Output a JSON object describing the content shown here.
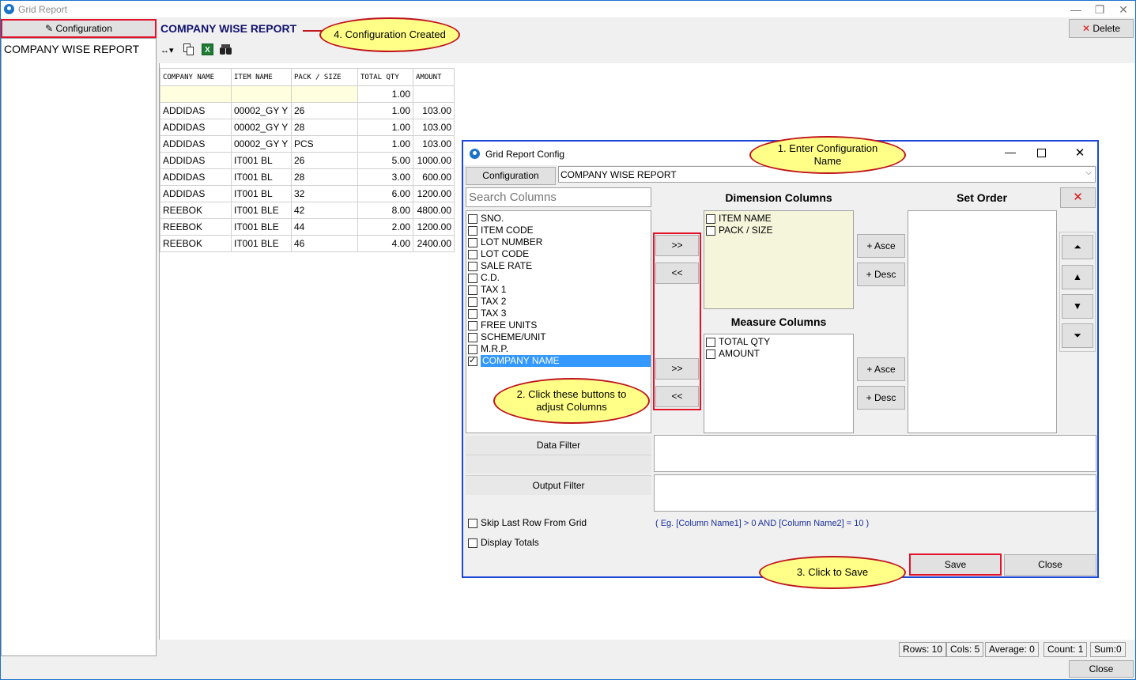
{
  "window": {
    "title": "Grid Report",
    "controls": {
      "minimize": "—",
      "restore": "❐",
      "close": "✕"
    }
  },
  "toolbar": {
    "configuration_label": "Configuration",
    "report_title": "COMPANY WISE REPORT",
    "delete_label": "Delete",
    "icons": [
      "fit-columns-icon",
      "copy-icon",
      "excel-icon",
      "binoculars-icon"
    ]
  },
  "sidebar": {
    "items": [
      {
        "label": "COMPANY WISE REPORT"
      }
    ]
  },
  "grid": {
    "columns": [
      "COMPANY NAME",
      "ITEM NAME",
      "PACK / SIZE",
      "TOTAL QTY",
      "AMOUNT"
    ],
    "rows": [
      [
        "",
        "",
        "",
        "1.00",
        ""
      ],
      [
        "ADDIDAS",
        "00002_GY Y",
        "26",
        "1.00",
        "103.00"
      ],
      [
        "ADDIDAS",
        "00002_GY Y",
        "28",
        "1.00",
        "103.00"
      ],
      [
        "ADDIDAS",
        "00002_GY Y",
        "PCS",
        "1.00",
        "103.00"
      ],
      [
        "ADDIDAS",
        "IT001 BL",
        "26",
        "5.00",
        "1000.00"
      ],
      [
        "ADDIDAS",
        "IT001 BL",
        "28",
        "3.00",
        "600.00"
      ],
      [
        "ADDIDAS",
        "IT001 BL",
        "32",
        "6.00",
        "1200.00"
      ],
      [
        "REEBOK",
        "IT001 BLE",
        "42",
        "8.00",
        "4800.00"
      ],
      [
        "REEBOK",
        "IT001 BLE",
        "44",
        "2.00",
        "1200.00"
      ],
      [
        "REEBOK",
        "IT001 BLE",
        "46",
        "4.00",
        "2400.00"
      ]
    ]
  },
  "status": {
    "rows": "Rows: 10",
    "cols": "Cols: 5",
    "average": "Average: 0",
    "count": "Count: 1",
    "sum": "Sum:0",
    "close_label": "Close"
  },
  "dialog": {
    "title": "Grid Report Config",
    "configuration_label": "Configuration",
    "configuration_value": "COMPANY WISE REPORT",
    "search_placeholder": "Search Columns",
    "columns": [
      {
        "label": "SNO.",
        "checked": false
      },
      {
        "label": "ITEM CODE",
        "checked": false
      },
      {
        "label": "LOT NUMBER",
        "checked": false
      },
      {
        "label": "LOT CODE",
        "checked": false
      },
      {
        "label": "SALE RATE",
        "checked": false
      },
      {
        "label": "C.D.",
        "checked": false
      },
      {
        "label": "TAX 1",
        "checked": false
      },
      {
        "label": "TAX 2",
        "checked": false
      },
      {
        "label": "TAX 3",
        "checked": false
      },
      {
        "label": "FREE UNITS",
        "checked": false
      },
      {
        "label": "SCHEME/UNIT",
        "checked": false
      },
      {
        "label": "M.R.P.",
        "checked": false
      },
      {
        "label": "COMPANY NAME",
        "checked": true
      }
    ],
    "dimension_header": "Dimension Columns",
    "dimension_columns": [
      "ITEM NAME",
      "PACK / SIZE"
    ],
    "measure_header": "Measure Columns",
    "measure_columns": [
      "TOTAL QTY",
      "AMOUNT"
    ],
    "set_order_header": "Set Order",
    "move_right": ">>",
    "move_left": "<<",
    "asce_label": "+ Asce",
    "desc_label": "+ Desc",
    "data_filter_label": "Data Filter",
    "output_filter_label": "Output Filter",
    "filter_hint": "( Eg. [Column Name1] > 0 AND [Column Name2] = 10 )",
    "skip_last_row_label": "Skip Last Row From Grid",
    "display_totals_label": "Display Totals",
    "save_label": "Save",
    "close_label": "Close"
  },
  "callouts": {
    "c1": "1. Enter Configuration Name",
    "c2": "2. Click these buttons to adjust Columns",
    "c3": "3. Click to Save",
    "c4": "4. Configuration Created"
  },
  "colors": {
    "accent": "#1a73c9",
    "highlight_red": "#e3122b",
    "callout_fill": "#ffff88",
    "title_blue": "#13136e"
  }
}
